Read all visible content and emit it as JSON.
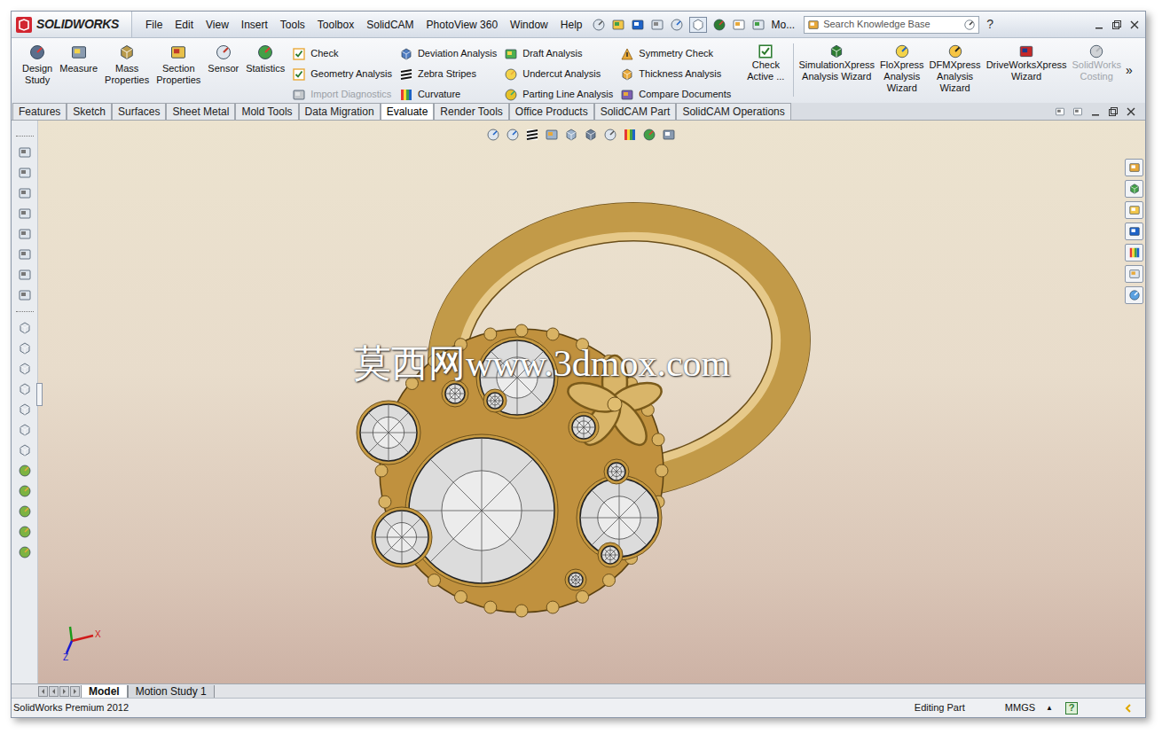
{
  "app": {
    "logo": "SOLIDWORKS"
  },
  "menu": [
    "File",
    "Edit",
    "View",
    "Insert",
    "Tools",
    "Toolbox",
    "SolidCAM",
    "PhotoView 360",
    "Window",
    "Help"
  ],
  "quick_access_more": "Mo...",
  "search": {
    "placeholder": "Search Knowledge Base"
  },
  "help_button": "?",
  "ribbon": {
    "large_buttons": [
      {
        "lines": [
          "Design",
          "Study"
        ]
      },
      {
        "lines": [
          "Measure"
        ]
      },
      {
        "lines": [
          "Mass",
          "Properties"
        ]
      },
      {
        "lines": [
          "Section",
          "Properties"
        ]
      },
      {
        "lines": [
          "Sensor"
        ]
      },
      {
        "lines": [
          "Statistics"
        ]
      }
    ],
    "columns": [
      [
        {
          "label": "Check",
          "disabled": false
        },
        {
          "label": "Geometry Analysis",
          "disabled": false
        },
        {
          "label": "Import Diagnostics",
          "disabled": true
        }
      ],
      [
        {
          "label": "Deviation Analysis",
          "disabled": false
        },
        {
          "label": "Zebra Stripes",
          "disabled": false
        },
        {
          "label": "Curvature",
          "disabled": false
        }
      ],
      [
        {
          "label": "Draft Analysis",
          "disabled": false
        },
        {
          "label": "Undercut Analysis",
          "disabled": false
        },
        {
          "label": "Parting Line Analysis",
          "disabled": false
        }
      ],
      [
        {
          "label": "Symmetry Check",
          "disabled": false
        },
        {
          "label": "Thickness Analysis",
          "disabled": false
        },
        {
          "label": "Compare Documents",
          "disabled": false
        }
      ]
    ],
    "check_active": {
      "lines": [
        "Check",
        "Active ..."
      ]
    },
    "wizards": [
      {
        "lines": [
          "SimulationXpress",
          "Analysis Wizard"
        ],
        "disabled": false
      },
      {
        "lines": [
          "FloXpress",
          "Analysis",
          "Wizard"
        ],
        "disabled": false
      },
      {
        "lines": [
          "DFMXpress",
          "Analysis",
          "Wizard"
        ],
        "disabled": false
      },
      {
        "lines": [
          "DriveWorksXpress",
          "Wizard"
        ],
        "disabled": false
      },
      {
        "lines": [
          "SolidWorks",
          "Costing"
        ],
        "disabled": true
      }
    ],
    "more": "»"
  },
  "tabs": [
    {
      "label": "Features",
      "selected": false
    },
    {
      "label": "Sketch",
      "selected": false
    },
    {
      "label": "Surfaces",
      "selected": false
    },
    {
      "label": "Sheet Metal",
      "selected": false
    },
    {
      "label": "Mold Tools",
      "selected": false
    },
    {
      "label": "Data Migration",
      "selected": false
    },
    {
      "label": "Evaluate",
      "selected": true
    },
    {
      "label": "Render Tools",
      "selected": false
    },
    {
      "label": "Office Products",
      "selected": false
    },
    {
      "label": "SolidCAM Part",
      "selected": false
    },
    {
      "label": "SolidCAM Operations",
      "selected": false
    }
  ],
  "viewport": {
    "watermark": "莫西网www.3dmox.com",
    "triad_axes": [
      "X",
      "Z"
    ]
  },
  "bottom_tabs": [
    {
      "label": "Model",
      "selected": true
    },
    {
      "label": "Motion Study 1",
      "selected": false
    }
  ],
  "status_bar": {
    "product": "SolidWorks Premium 2012",
    "mode": "Editing Part",
    "units": "MMGS",
    "units_menu": "▲",
    "help": "?"
  }
}
